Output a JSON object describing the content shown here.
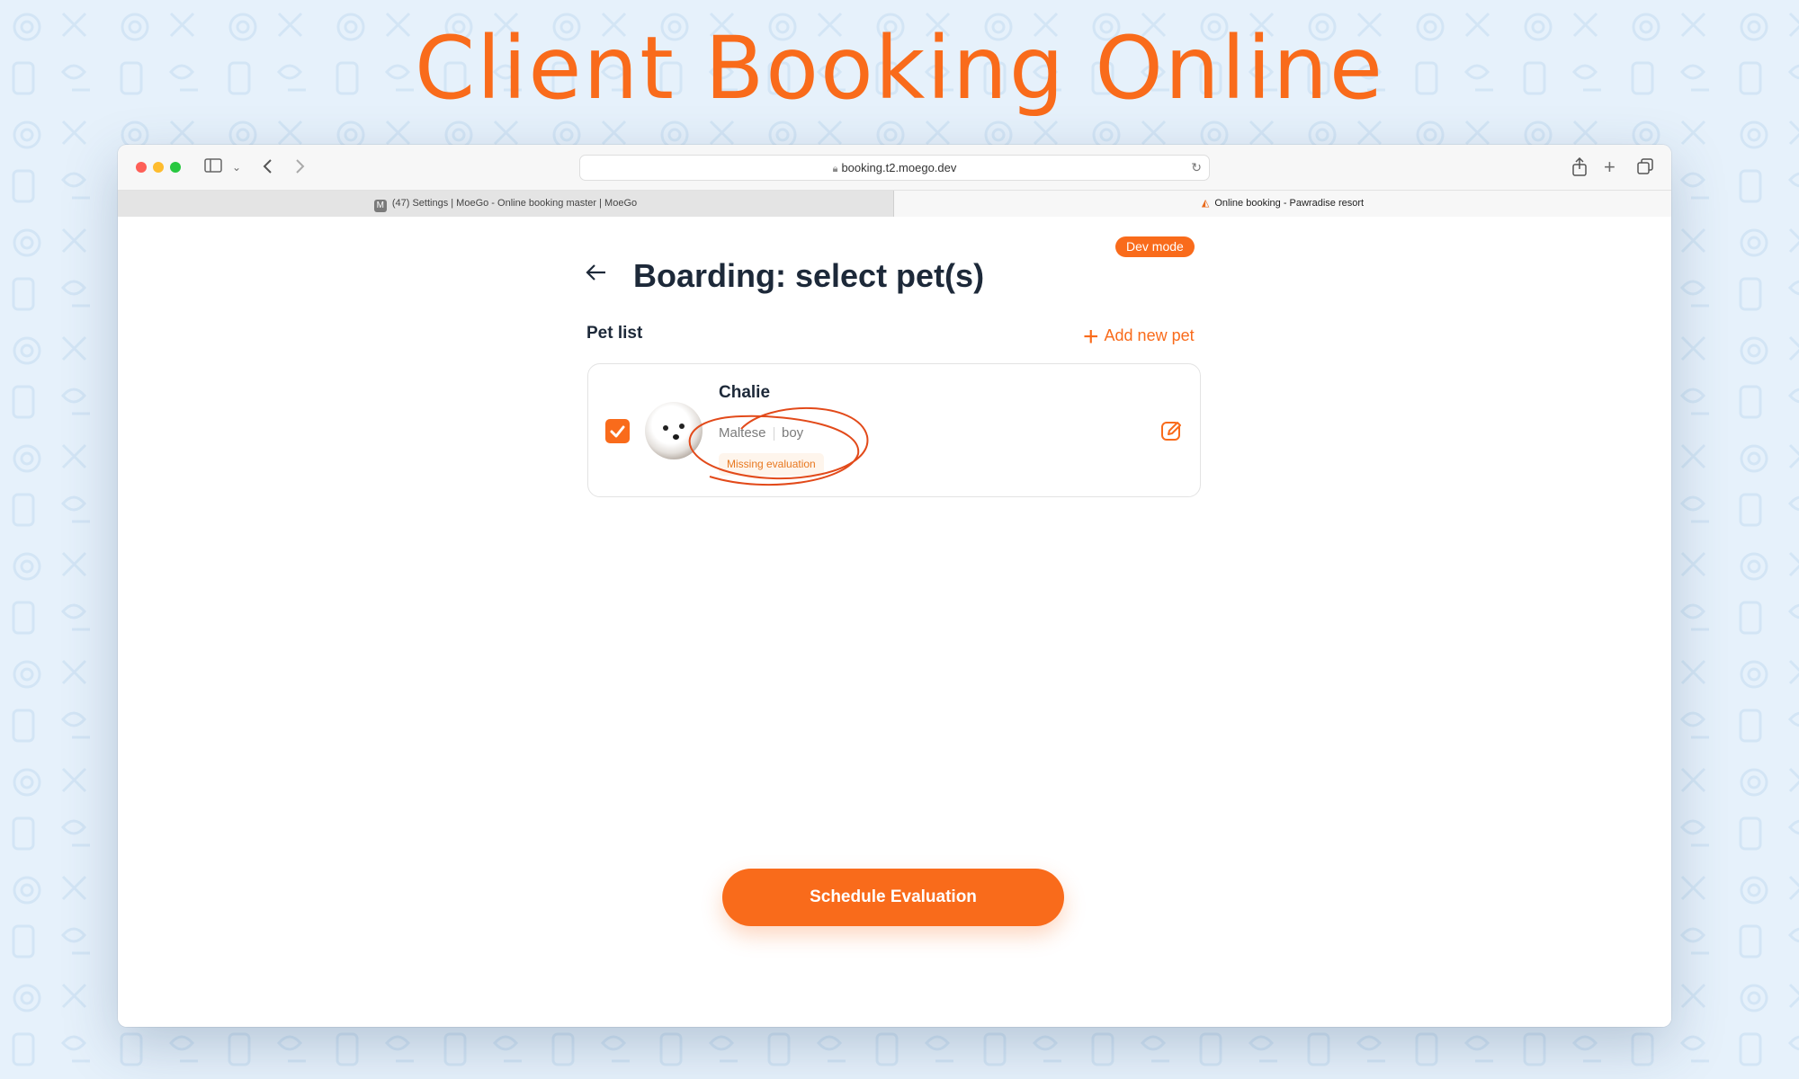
{
  "hero": {
    "title": "Client Booking Online"
  },
  "browser": {
    "url": "booking.t2.moego.dev",
    "tabs": [
      {
        "favicon": "M",
        "label": "(47) Settings | MoeGo - Online booking master | MoeGo"
      },
      {
        "label": "Online booking - Pawradise resort"
      }
    ],
    "icons": [
      "sidebar-icon",
      "chevron-down-icon",
      "back-icon",
      "forward-icon",
      "lock-icon",
      "reload-icon",
      "share-icon",
      "new-tab-icon",
      "tabs-overview-icon"
    ]
  },
  "page": {
    "dev_badge": "Dev mode",
    "title": "Boarding: select pet(s)",
    "pet_list_label": "Pet list",
    "add_pet_label": "Add new pet",
    "pets": [
      {
        "name": "Chalie",
        "breed": "Maltese",
        "gender": "boy",
        "badge": "Missing evaluation",
        "selected": true
      }
    ],
    "cta_label": "Schedule Evaluation"
  },
  "colors": {
    "accent": "#f96b1b",
    "background": "#e6f1fb",
    "text_dark": "#1d2939",
    "badge_bg": "#fef5ec"
  }
}
